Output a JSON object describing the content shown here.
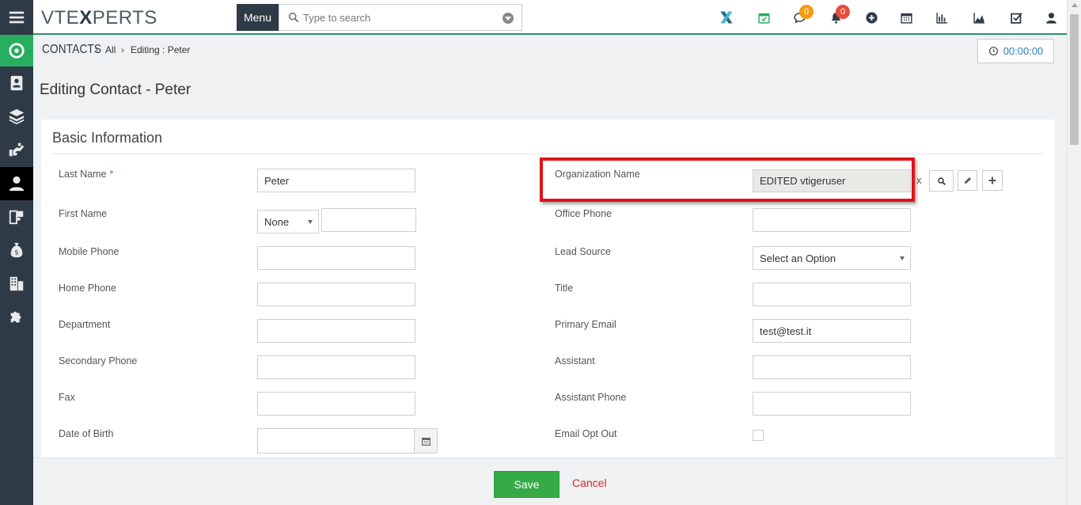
{
  "app": {
    "logo_prefix": "VTE",
    "logo_x": "X",
    "logo_suffix": "PERTS",
    "menu_label": "Menu",
    "search_placeholder": "Type to search"
  },
  "topbar": {
    "chat_badge": "0",
    "notification_badge": "0"
  },
  "breadcrumb": {
    "module": "CONTACTS",
    "filter": "All",
    "current": "Editing : Peter"
  },
  "timer": "00:00:00",
  "page_title": "Editing Contact - Peter",
  "section_title": "Basic Information",
  "fields": {
    "last_name": {
      "label": "Last Name",
      "required": "*",
      "value": "Peter"
    },
    "first_name": {
      "label": "First Name",
      "salutation": "None",
      "value": ""
    },
    "mobile_phone": {
      "label": "Mobile Phone",
      "value": ""
    },
    "home_phone": {
      "label": "Home Phone",
      "value": ""
    },
    "department": {
      "label": "Department",
      "value": ""
    },
    "secondary_phone": {
      "label": "Secondary Phone",
      "value": ""
    },
    "fax": {
      "label": "Fax",
      "value": ""
    },
    "date_of_birth": {
      "label": "Date of Birth",
      "value": ""
    },
    "organization_name": {
      "label": "Organization Name",
      "value": "EDITED vtigeruser",
      "clear": "x"
    },
    "office_phone": {
      "label": "Office Phone",
      "value": ""
    },
    "lead_source": {
      "label": "Lead Source",
      "value": "Select an Option"
    },
    "title": {
      "label": "Title",
      "value": ""
    },
    "primary_email": {
      "label": "Primary Email",
      "value": "test@test.it"
    },
    "assistant": {
      "label": "Assistant",
      "value": ""
    },
    "assistant_phone": {
      "label": "Assistant Phone",
      "value": ""
    },
    "email_opt_out": {
      "label": "Email Opt Out",
      "checked": false
    }
  },
  "footer": {
    "save_label": "Save",
    "cancel_label": "Cancel"
  },
  "colors": {
    "sidebar": "#2e3a45",
    "accent_green": "#27ae60",
    "save_green": "#35aa47",
    "highlight_red": "#e0131a",
    "cancel_red": "#e02424",
    "timer_blue": "#2e80b8"
  }
}
